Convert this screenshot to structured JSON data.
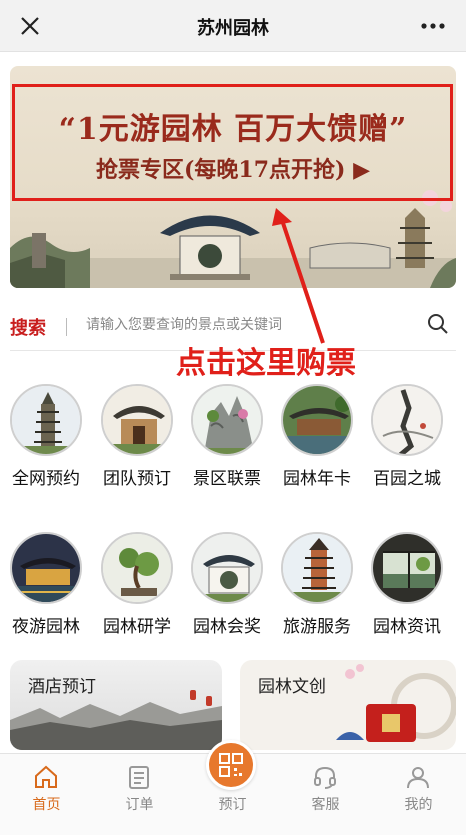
{
  "navbar": {
    "title": "苏州园林",
    "close_icon": "close-icon",
    "more_icon": "more-icon"
  },
  "banner": {
    "line1": "“1元游园林  百万大馈赠”",
    "line2": "抢票专区(每晚17点开抢) ▶"
  },
  "search": {
    "label": "搜索",
    "placeholder": "请输入您要查询的景点或关键词",
    "icon": "search-icon"
  },
  "annotation": {
    "text": "点击这里购票",
    "color": "#e0201a"
  },
  "grid": [
    {
      "label": "全网预约"
    },
    {
      "label": "团队预订"
    },
    {
      "label": "景区联票"
    },
    {
      "label": "园林年卡"
    },
    {
      "label": "百园之城"
    },
    {
      "label": "夜游园林"
    },
    {
      "label": "园林研学"
    },
    {
      "label": "园林会奖"
    },
    {
      "label": "旅游服务"
    },
    {
      "label": "园林资讯"
    }
  ],
  "cards": {
    "hotel": "酒店预订",
    "culture": "园林文创"
  },
  "tabbar": [
    {
      "label": "首页",
      "icon": "home-icon",
      "active": true
    },
    {
      "label": "订单",
      "icon": "order-icon",
      "active": false
    },
    {
      "label": "预订",
      "icon": "qr-code-icon",
      "active": false
    },
    {
      "label": "客服",
      "icon": "headset-icon",
      "active": false
    },
    {
      "label": "我的",
      "icon": "user-icon",
      "active": false
    }
  ],
  "colors": {
    "accent": "#d86a1c",
    "search_label": "#c81e1e",
    "highlight_border": "#e0201a"
  }
}
